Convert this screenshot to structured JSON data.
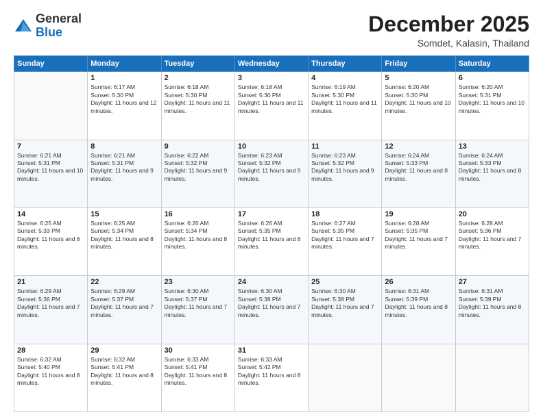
{
  "header": {
    "logo": {
      "general": "General",
      "blue": "Blue"
    },
    "title": "December 2025",
    "location": "Somdet, Kalasin, Thailand"
  },
  "calendar": {
    "days_of_week": [
      "Sunday",
      "Monday",
      "Tuesday",
      "Wednesday",
      "Thursday",
      "Friday",
      "Saturday"
    ],
    "weeks": [
      [
        {
          "day": "",
          "sunrise": "",
          "sunset": "",
          "daylight": "",
          "empty": true
        },
        {
          "day": "1",
          "sunrise": "Sunrise: 6:17 AM",
          "sunset": "Sunset: 5:30 PM",
          "daylight": "Daylight: 11 hours and 12 minutes."
        },
        {
          "day": "2",
          "sunrise": "Sunrise: 6:18 AM",
          "sunset": "Sunset: 5:30 PM",
          "daylight": "Daylight: 11 hours and 11 minutes."
        },
        {
          "day": "3",
          "sunrise": "Sunrise: 6:18 AM",
          "sunset": "Sunset: 5:30 PM",
          "daylight": "Daylight: 11 hours and 11 minutes."
        },
        {
          "day": "4",
          "sunrise": "Sunrise: 6:19 AM",
          "sunset": "Sunset: 5:30 PM",
          "daylight": "Daylight: 11 hours and 11 minutes."
        },
        {
          "day": "5",
          "sunrise": "Sunrise: 6:20 AM",
          "sunset": "Sunset: 5:30 PM",
          "daylight": "Daylight: 11 hours and 10 minutes."
        },
        {
          "day": "6",
          "sunrise": "Sunrise: 6:20 AM",
          "sunset": "Sunset: 5:31 PM",
          "daylight": "Daylight: 11 hours and 10 minutes."
        }
      ],
      [
        {
          "day": "7",
          "sunrise": "Sunrise: 6:21 AM",
          "sunset": "Sunset: 5:31 PM",
          "daylight": "Daylight: 11 hours and 10 minutes."
        },
        {
          "day": "8",
          "sunrise": "Sunrise: 6:21 AM",
          "sunset": "Sunset: 5:31 PM",
          "daylight": "Daylight: 11 hours and 9 minutes."
        },
        {
          "day": "9",
          "sunrise": "Sunrise: 6:22 AM",
          "sunset": "Sunset: 5:32 PM",
          "daylight": "Daylight: 11 hours and 9 minutes."
        },
        {
          "day": "10",
          "sunrise": "Sunrise: 6:23 AM",
          "sunset": "Sunset: 5:32 PM",
          "daylight": "Daylight: 11 hours and 9 minutes."
        },
        {
          "day": "11",
          "sunrise": "Sunrise: 6:23 AM",
          "sunset": "Sunset: 5:32 PM",
          "daylight": "Daylight: 11 hours and 9 minutes."
        },
        {
          "day": "12",
          "sunrise": "Sunrise: 6:24 AM",
          "sunset": "Sunset: 5:33 PM",
          "daylight": "Daylight: 11 hours and 8 minutes."
        },
        {
          "day": "13",
          "sunrise": "Sunrise: 6:24 AM",
          "sunset": "Sunset: 5:33 PM",
          "daylight": "Daylight: 11 hours and 8 minutes."
        }
      ],
      [
        {
          "day": "14",
          "sunrise": "Sunrise: 6:25 AM",
          "sunset": "Sunset: 5:33 PM",
          "daylight": "Daylight: 11 hours and 8 minutes."
        },
        {
          "day": "15",
          "sunrise": "Sunrise: 6:25 AM",
          "sunset": "Sunset: 5:34 PM",
          "daylight": "Daylight: 11 hours and 8 minutes."
        },
        {
          "day": "16",
          "sunrise": "Sunrise: 6:26 AM",
          "sunset": "Sunset: 5:34 PM",
          "daylight": "Daylight: 11 hours and 8 minutes."
        },
        {
          "day": "17",
          "sunrise": "Sunrise: 6:26 AM",
          "sunset": "Sunset: 5:35 PM",
          "daylight": "Daylight: 11 hours and 8 minutes."
        },
        {
          "day": "18",
          "sunrise": "Sunrise: 6:27 AM",
          "sunset": "Sunset: 5:35 PM",
          "daylight": "Daylight: 11 hours and 7 minutes."
        },
        {
          "day": "19",
          "sunrise": "Sunrise: 6:28 AM",
          "sunset": "Sunset: 5:35 PM",
          "daylight": "Daylight: 11 hours and 7 minutes."
        },
        {
          "day": "20",
          "sunrise": "Sunrise: 6:28 AM",
          "sunset": "Sunset: 5:36 PM",
          "daylight": "Daylight: 11 hours and 7 minutes."
        }
      ],
      [
        {
          "day": "21",
          "sunrise": "Sunrise: 6:29 AM",
          "sunset": "Sunset: 5:36 PM",
          "daylight": "Daylight: 11 hours and 7 minutes."
        },
        {
          "day": "22",
          "sunrise": "Sunrise: 6:29 AM",
          "sunset": "Sunset: 5:37 PM",
          "daylight": "Daylight: 11 hours and 7 minutes."
        },
        {
          "day": "23",
          "sunrise": "Sunrise: 6:30 AM",
          "sunset": "Sunset: 5:37 PM",
          "daylight": "Daylight: 11 hours and 7 minutes."
        },
        {
          "day": "24",
          "sunrise": "Sunrise: 6:30 AM",
          "sunset": "Sunset: 5:38 PM",
          "daylight": "Daylight: 11 hours and 7 minutes."
        },
        {
          "day": "25",
          "sunrise": "Sunrise: 6:30 AM",
          "sunset": "Sunset: 5:38 PM",
          "daylight": "Daylight: 11 hours and 7 minutes."
        },
        {
          "day": "26",
          "sunrise": "Sunrise: 6:31 AM",
          "sunset": "Sunset: 5:39 PM",
          "daylight": "Daylight: 11 hours and 8 minutes."
        },
        {
          "day": "27",
          "sunrise": "Sunrise: 6:31 AM",
          "sunset": "Sunset: 5:39 PM",
          "daylight": "Daylight: 11 hours and 8 minutes."
        }
      ],
      [
        {
          "day": "28",
          "sunrise": "Sunrise: 6:32 AM",
          "sunset": "Sunset: 5:40 PM",
          "daylight": "Daylight: 11 hours and 8 minutes."
        },
        {
          "day": "29",
          "sunrise": "Sunrise: 6:32 AM",
          "sunset": "Sunset: 5:41 PM",
          "daylight": "Daylight: 11 hours and 8 minutes."
        },
        {
          "day": "30",
          "sunrise": "Sunrise: 6:33 AM",
          "sunset": "Sunset: 5:41 PM",
          "daylight": "Daylight: 11 hours and 8 minutes."
        },
        {
          "day": "31",
          "sunrise": "Sunrise: 6:33 AM",
          "sunset": "Sunset: 5:42 PM",
          "daylight": "Daylight: 11 hours and 8 minutes."
        },
        {
          "day": "",
          "sunrise": "",
          "sunset": "",
          "daylight": "",
          "empty": true
        },
        {
          "day": "",
          "sunrise": "",
          "sunset": "",
          "daylight": "",
          "empty": true
        },
        {
          "day": "",
          "sunrise": "",
          "sunset": "",
          "daylight": "",
          "empty": true
        }
      ]
    ]
  }
}
